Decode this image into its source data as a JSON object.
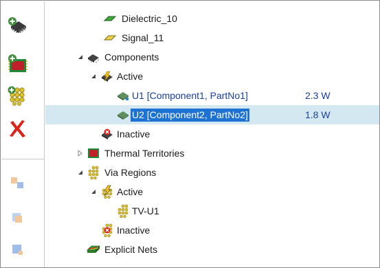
{
  "toolbar": {
    "buttons": [
      {
        "icon": "add-chip-icon",
        "enabled": true
      },
      {
        "icon": "add-board-icon",
        "enabled": true
      },
      {
        "icon": "add-via-region-icon",
        "enabled": true
      },
      {
        "icon": "delete-icon",
        "enabled": true
      },
      {
        "icon": "move-icon",
        "enabled": false
      },
      {
        "icon": "copy-icon",
        "enabled": false
      },
      {
        "icon": "paste-icon",
        "enabled": false
      }
    ]
  },
  "tree": {
    "rows": [
      {
        "label": "Dielectric_10",
        "icon": "dielectric-layer-icon",
        "expander": "none"
      },
      {
        "label": "Signal_11",
        "icon": "signal-layer-icon",
        "expander": "none"
      },
      {
        "label": "Components",
        "icon": "components-icon",
        "expander": "expanded"
      },
      {
        "label": "Active",
        "icon": "active-components-icon",
        "expander": "expanded"
      },
      {
        "label": "U1 [Component1, PartNo1]",
        "value": "2.3 W",
        "icon": "component-icon",
        "expander": "none",
        "link": true
      },
      {
        "label": "U2 [Component2, PartNo2]",
        "value": "1.8 W",
        "icon": "component-icon",
        "expander": "none",
        "selected": true
      },
      {
        "label": "Inactive",
        "icon": "inactive-components-icon",
        "expander": "none"
      },
      {
        "label": "Thermal Territories",
        "icon": "thermal-territory-icon",
        "expander": "collapsed"
      },
      {
        "label": "Via Regions",
        "icon": "via-regions-icon",
        "expander": "expanded"
      },
      {
        "label": "Active",
        "icon": "active-via-icon",
        "expander": "expanded"
      },
      {
        "label": "TV-U1",
        "icon": "via-region-icon",
        "expander": "none"
      },
      {
        "label": "Inactive",
        "icon": "inactive-via-icon",
        "expander": "none"
      },
      {
        "label": "Explicit Nets",
        "icon": "explicit-nets-icon",
        "expander": "none"
      }
    ]
  },
  "colors": {
    "selection_row": "#d4e8f1",
    "selection_text_bg": "#1e73d2",
    "link_text": "#1a3e9e",
    "chip_green": "#3e8f3a",
    "delete_red": "#d9251b"
  }
}
